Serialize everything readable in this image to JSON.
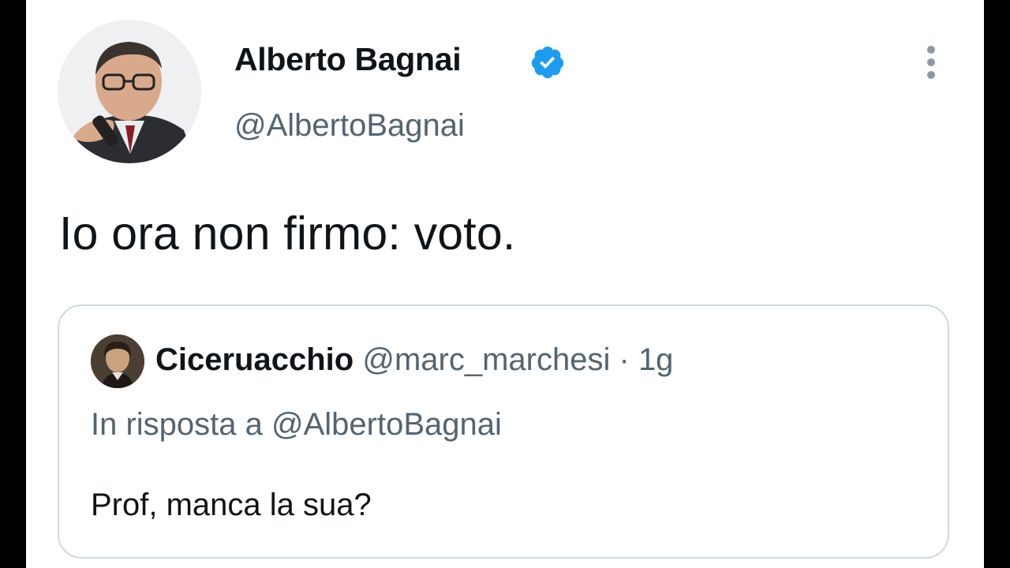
{
  "tweet": {
    "display_name": "Alberto Bagnai",
    "handle": "@AlbertoBagnai",
    "text": "Io ora non firmo: voto.",
    "verified_icon": "verified-badge-icon",
    "more_icon": "more-vertical-icon"
  },
  "quote": {
    "author_name": "Ciceruacchio",
    "author_handle": "@marc_marchesi",
    "separator": "·",
    "time": "1g",
    "reply_to": "In risposta a @AlbertoBagnai",
    "text": "Prof, manca la sua?"
  },
  "colors": {
    "text_primary": "#0f1419",
    "text_secondary": "#536471",
    "verified_blue": "#1d9bf0",
    "border": "#cfd9de"
  }
}
